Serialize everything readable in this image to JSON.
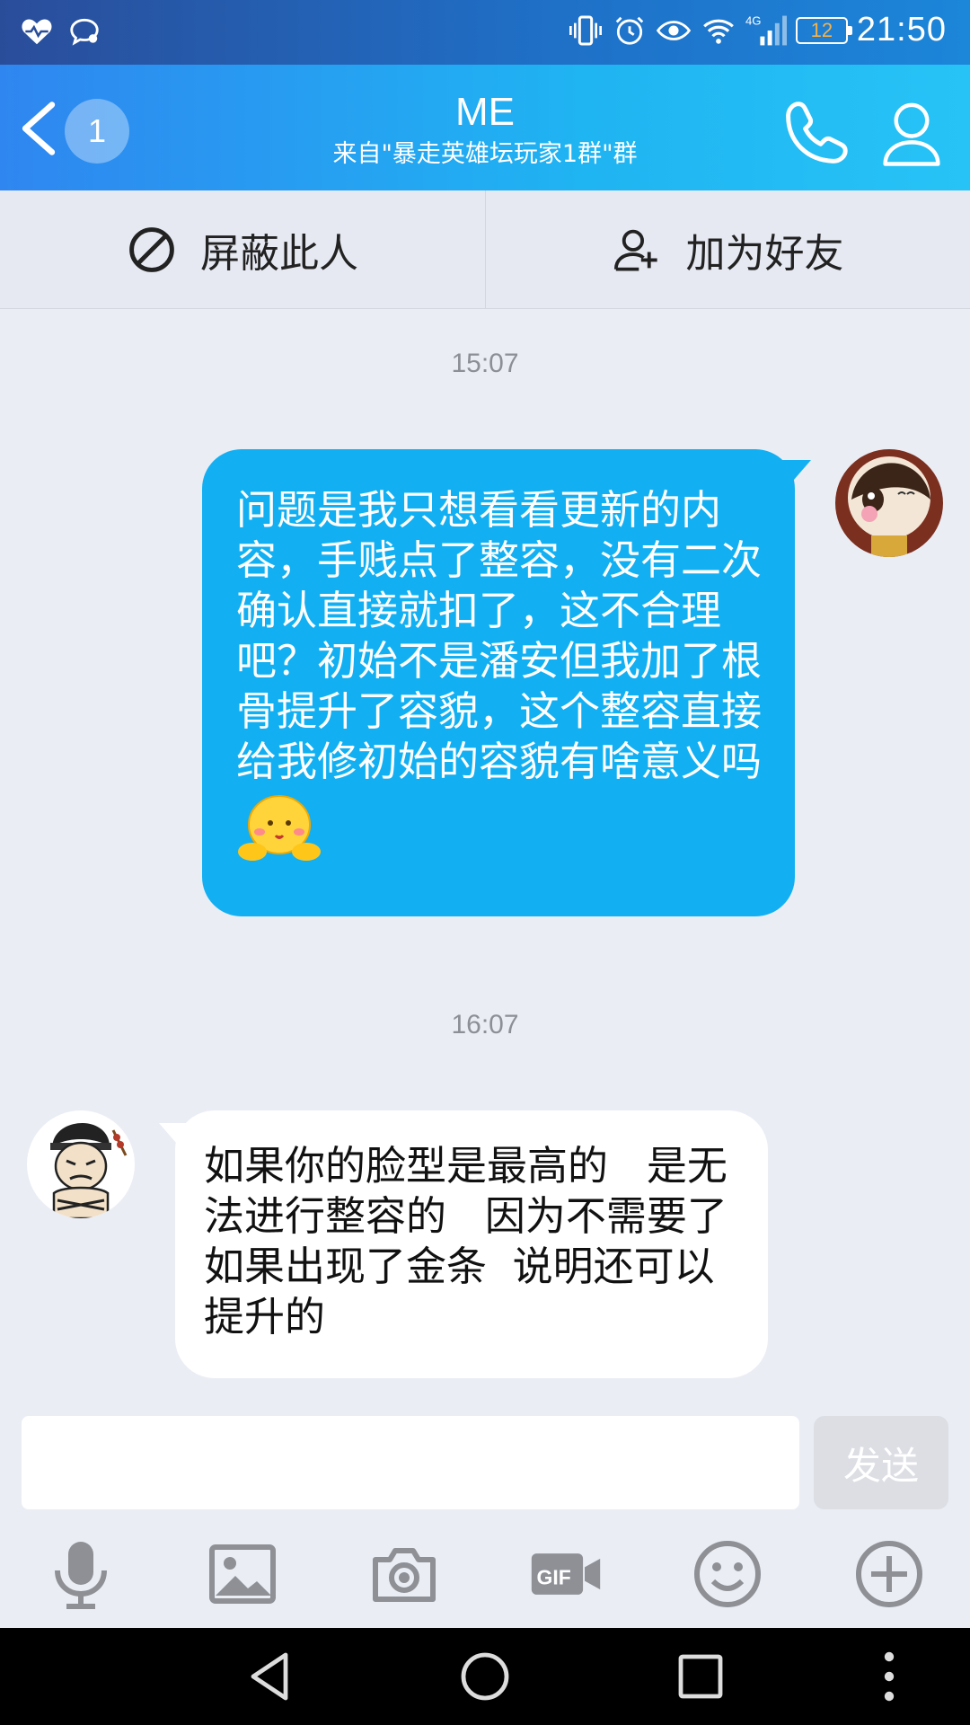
{
  "status_bar": {
    "time": "21:50",
    "battery": "12"
  },
  "header": {
    "unread_count": "1",
    "title": "ME",
    "subtitle": "来自\"暴走英雄坛玩家1群\"群"
  },
  "actions": {
    "block_label": "屏蔽此人",
    "add_friend_label": "加为好友"
  },
  "messages": [
    {
      "time": "15:07",
      "direction": "out",
      "text": "问题是我只想看看更新的内容，手贱点了整容，没有二次确认直接就扣了，这不合理吧？初始不是潘安但我加了根骨提升了容貌，这个整容直接给我修初始的容貌有啥意义吗"
    },
    {
      "time": "16:07",
      "direction": "in",
      "text": "如果你的脸型是最高的   是无法进行整容的   因为不需要了   如果出现了金条  说明还可以提升的"
    }
  ],
  "input": {
    "send_label": "发送"
  },
  "toolbar": {
    "icons": [
      "microphone-icon",
      "image-icon",
      "camera-icon",
      "gif-icon",
      "emoji-icon",
      "plus-icon"
    ]
  },
  "colors": {
    "header": "#1fb4f2",
    "out_bubble": "#12b0f2",
    "background": "#ebedf5"
  }
}
